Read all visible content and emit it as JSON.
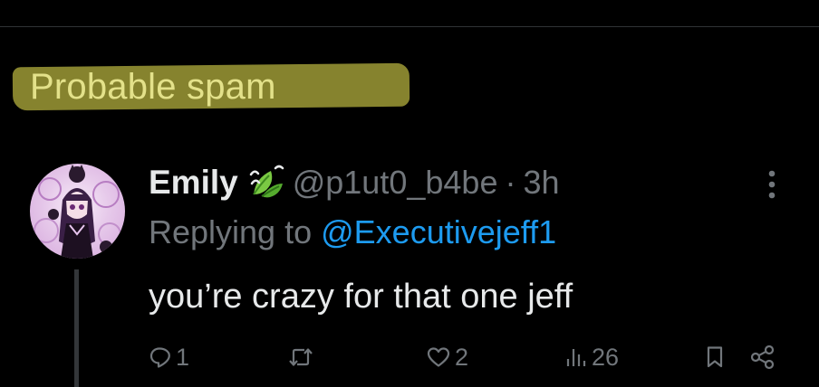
{
  "annotation": {
    "label": "Probable spam",
    "highlight_color": "#86832e",
    "text_color": "#e3e18a"
  },
  "tweet": {
    "author": {
      "display_name": "Emily",
      "badge_icon": "leaf-emoji-icon",
      "handle": "@p1ut0_b4be"
    },
    "separator": "·",
    "timestamp": "3h",
    "reply": {
      "prefix": "Replying to",
      "mention": "@Executivejeff1"
    },
    "text": "you’re crazy for that one jeff",
    "actions": {
      "reply_count": "1",
      "retweet_count": "",
      "like_count": "2",
      "views_count": "26"
    }
  },
  "colors": {
    "background": "#000000",
    "primary_text": "#e7e9ea",
    "secondary_text": "#71767b",
    "link": "#1d9bf0",
    "divider": "#2f3336"
  }
}
